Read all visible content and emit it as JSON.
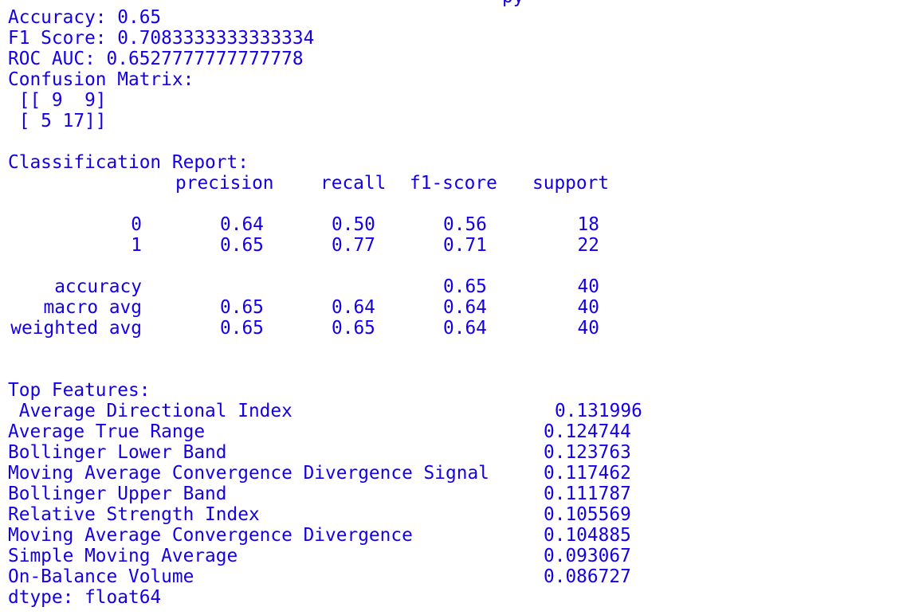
{
  "top_partial": "py",
  "metrics": {
    "accuracy": "Accuracy: 0.65",
    "f1": "F1 Score: 0.7083333333333334",
    "roc_auc": "ROC AUC: 0.6527777777777778",
    "confusion_title": "Confusion Matrix:",
    "confusion_row1": " [[ 9  9]",
    "confusion_row2": " [ 5 17]]"
  },
  "report": {
    "title": "Classification Report:",
    "headers": [
      "precision",
      "recall",
      "f1-score",
      "support"
    ],
    "rows": [
      {
        "label": "0",
        "precision": "0.64",
        "recall": "0.50",
        "f1": "0.56",
        "support": "18"
      },
      {
        "label": "1",
        "precision": "0.65",
        "recall": "0.77",
        "f1": "0.71",
        "support": "22"
      }
    ],
    "summary": [
      {
        "label": "accuracy",
        "precision": "",
        "recall": "",
        "f1": "0.65",
        "support": "40"
      },
      {
        "label": "macro avg",
        "precision": "0.65",
        "recall": "0.64",
        "f1": "0.64",
        "support": "40"
      },
      {
        "label": "weighted avg",
        "precision": "0.65",
        "recall": "0.65",
        "f1": "0.64",
        "support": "40"
      }
    ]
  },
  "features": {
    "title": "Top Features:",
    "items": [
      {
        "name": " Average Directional Index",
        "value": "0.131996"
      },
      {
        "name": "Average True Range",
        "value": "0.124744"
      },
      {
        "name": "Bollinger Lower Band",
        "value": "0.123763"
      },
      {
        "name": "Moving Average Convergence Divergence Signal",
        "value": "0.117462"
      },
      {
        "name": "Bollinger Upper Band",
        "value": "0.111787"
      },
      {
        "name": "Relative Strength Index",
        "value": "0.105569"
      },
      {
        "name": "Moving Average Convergence Divergence",
        "value": "0.104885"
      },
      {
        "name": "Simple Moving Average",
        "value": "0.093067"
      },
      {
        "name": "On-Balance Volume",
        "value": "0.086727"
      }
    ],
    "dtype": "dtype: float64"
  }
}
